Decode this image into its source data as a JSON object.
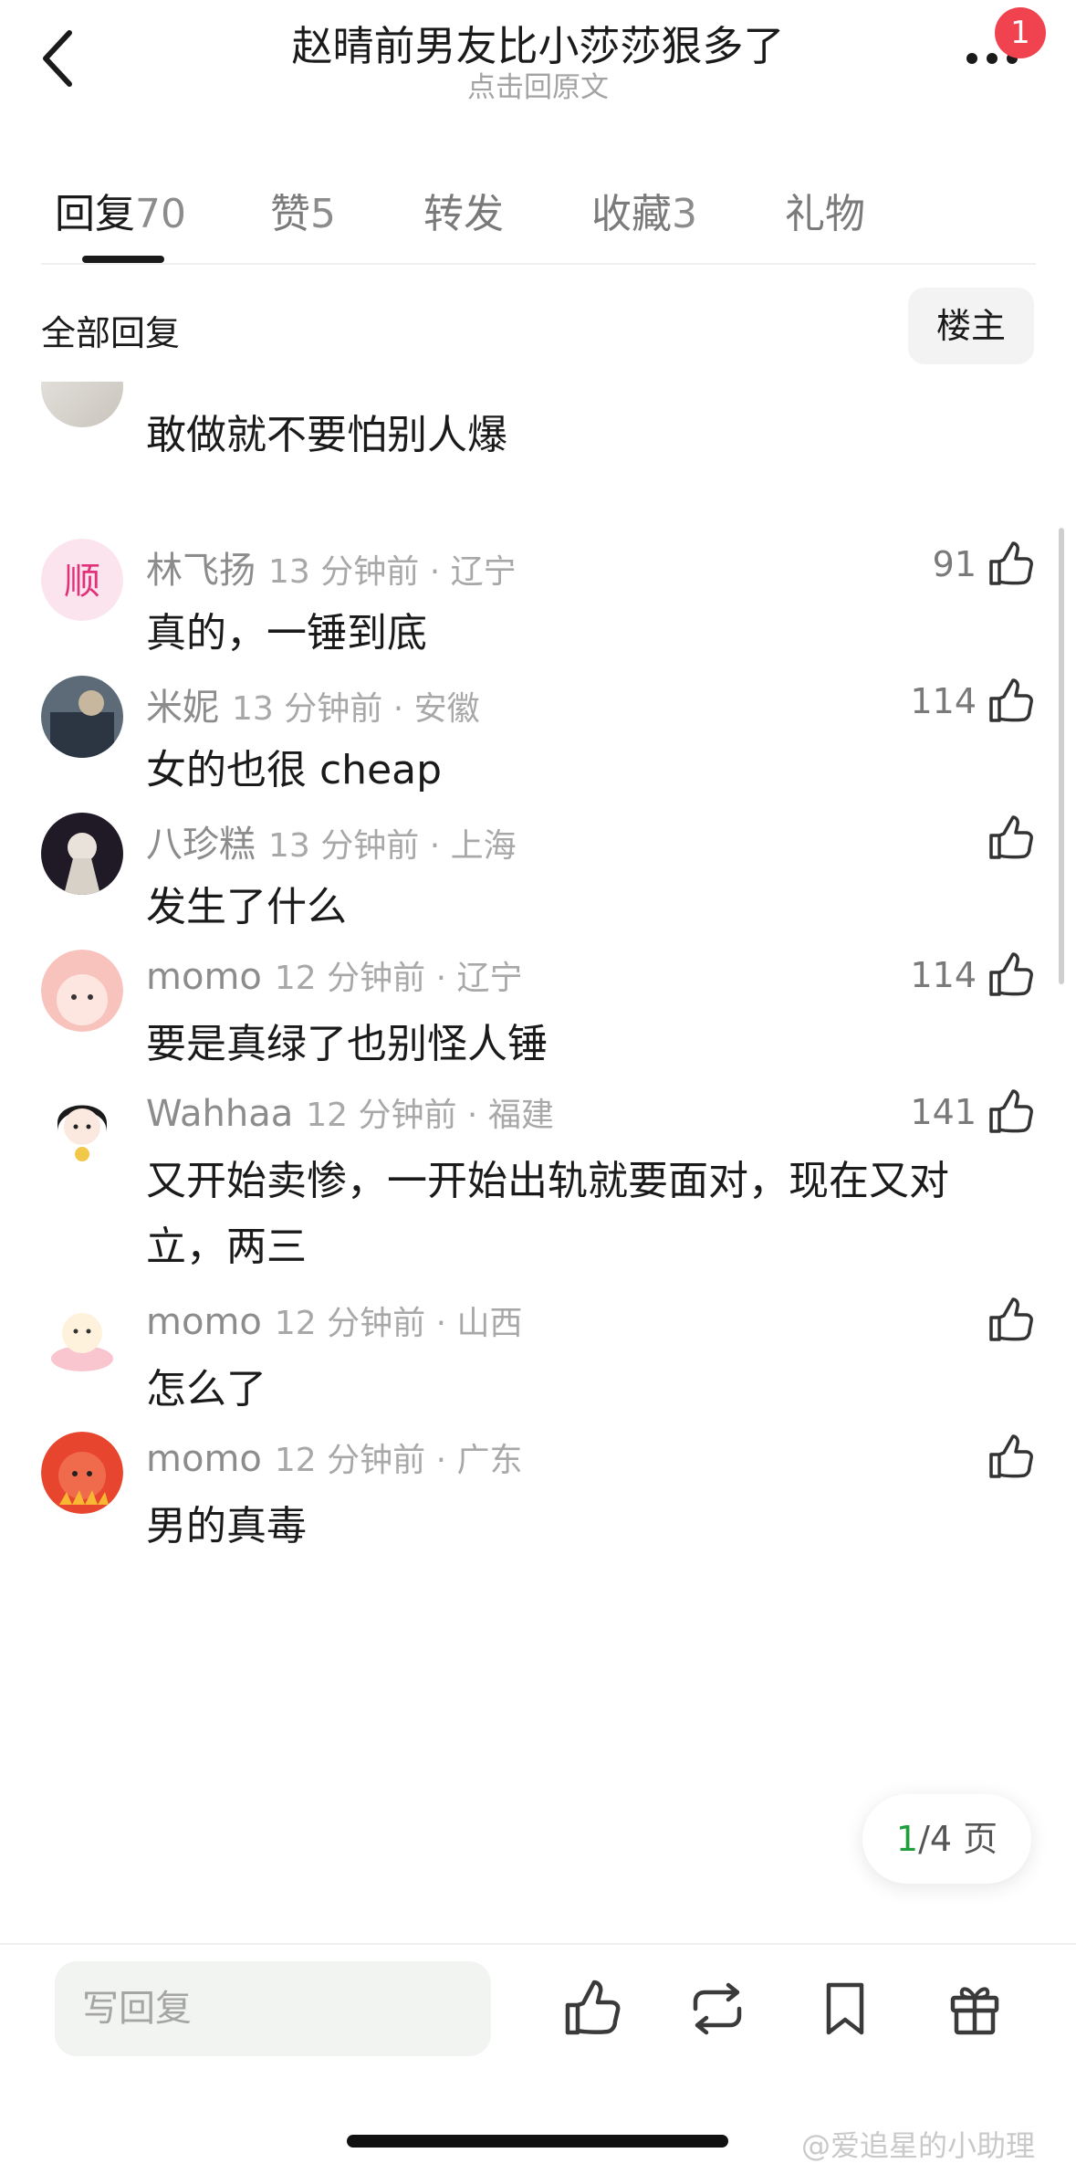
{
  "header": {
    "title": "赵晴前男友比小莎莎狠多了",
    "subtitle": "点击回原文",
    "notification_count": "1"
  },
  "tabs": [
    {
      "label": "回复",
      "count": "70",
      "active": true
    },
    {
      "label": "赞",
      "count": "5"
    },
    {
      "label": "转发",
      "count": ""
    },
    {
      "label": "收藏",
      "count": "3"
    },
    {
      "label": "礼物",
      "count": ""
    }
  ],
  "section": {
    "title": "全部回复",
    "filter_button": "楼主"
  },
  "partial_comment": {
    "content": "敢做就不要怕别人爆"
  },
  "comments": [
    {
      "name": "林飞扬",
      "time": "13 分钟前 · 辽宁",
      "content": "真的，一锤到底",
      "likes": "91",
      "avatar_color": "#f7d6e4"
    },
    {
      "name": "米妮",
      "time": "13 分钟前 · 安徽",
      "content": "女的也很 cheap",
      "likes": "114",
      "avatar_color": "#3b4a5c"
    },
    {
      "name": "八珍糕",
      "time": "13 分钟前 · 上海",
      "content": "发生了什么",
      "likes": "",
      "avatar_color": "#2b2230"
    },
    {
      "name": "momo",
      "time": "12 分钟前 · 辽宁",
      "content": "要是真绿了也别怪人锤",
      "likes": "114",
      "avatar_color": "#f6b3b0"
    },
    {
      "name": "Wahhaa",
      "time": "12 分钟前 · 福建",
      "content": "又开始卖惨，一开始出轨就要面对，现在又对立，两三",
      "likes": "141",
      "avatar_color": "#ffffff"
    },
    {
      "name": "momo",
      "time": "12 分钟前 · 山西",
      "content": "怎么了",
      "likes": "",
      "avatar_color": "#fde9c9"
    },
    {
      "name": "momo",
      "time": "12 分钟前 · 广东",
      "content": "男的真毒",
      "likes": "",
      "avatar_color": "#e8452f"
    }
  ],
  "pagination": {
    "current": "1",
    "total_text": "/4 页"
  },
  "bottom_bar": {
    "reply_placeholder": "写回复"
  },
  "watermark": "@爱追星的小助理"
}
